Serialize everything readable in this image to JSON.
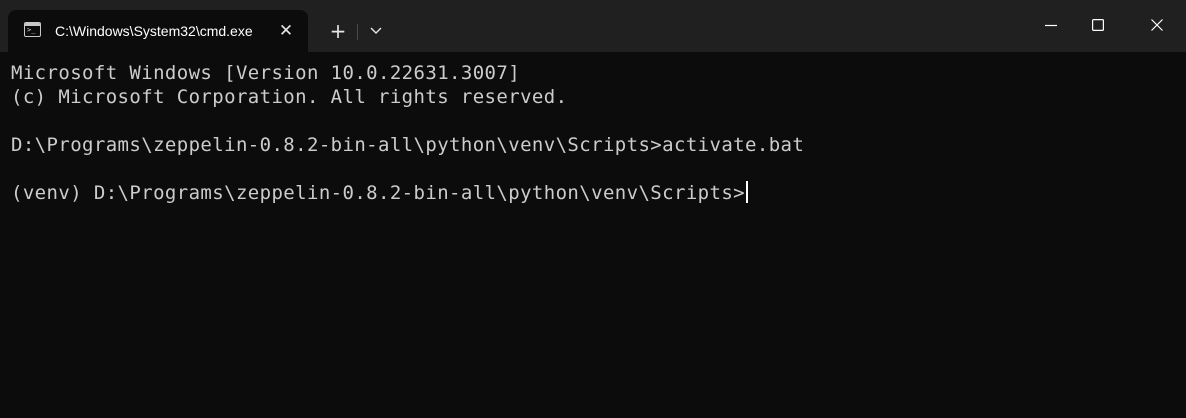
{
  "tab": {
    "title": "C:\\Windows\\System32\\cmd.exe",
    "icon": "cmd-icon",
    "close_glyph": "✕"
  },
  "titlebar": {
    "new_tab_glyph": "+",
    "dropdown_icon": "chevron-down-icon",
    "minimize_icon": "minimize-icon",
    "maximize_icon": "maximize-icon",
    "close_icon": "close-icon"
  },
  "console": {
    "lines": [
      "Microsoft Windows [Version 10.0.22631.3007]",
      "(c) Microsoft Corporation. All rights reserved.",
      "",
      "D:\\Programs\\zeppelin-0.8.2-bin-all\\python\\venv\\Scripts>activate.bat",
      "",
      "(venv) D:\\Programs\\zeppelin-0.8.2-bin-all\\python\\venv\\Scripts>"
    ]
  },
  "colors": {
    "background": "#0c0c0c",
    "titlebar": "#202020",
    "text": "#cccccc"
  }
}
